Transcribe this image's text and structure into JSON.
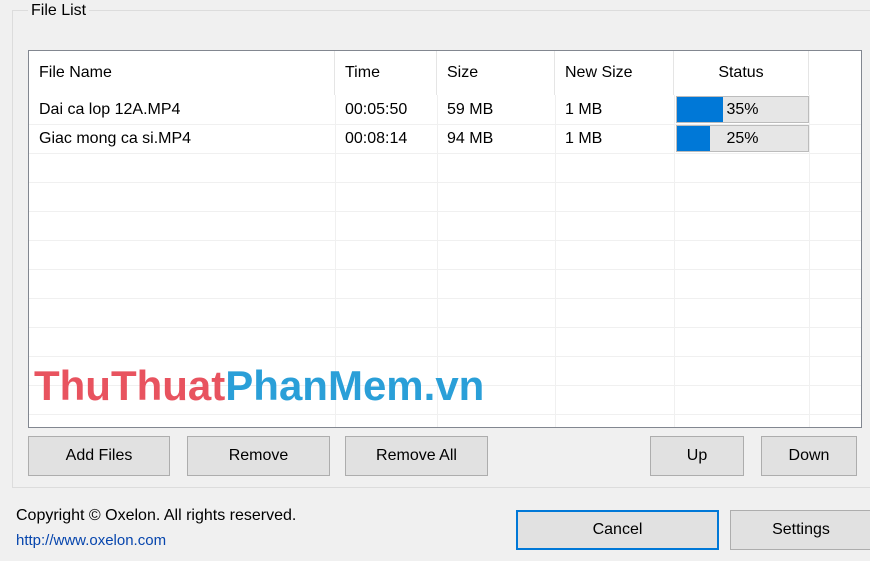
{
  "groupbox": {
    "title": "File List"
  },
  "columns": [
    {
      "label": "File Name"
    },
    {
      "label": "Time"
    },
    {
      "label": "Size"
    },
    {
      "label": "New Size"
    },
    {
      "label": "Status"
    }
  ],
  "files": [
    {
      "name": "Dai ca lop 12A.MP4",
      "time": "00:05:50",
      "size": "59 MB",
      "new_size": "1 MB",
      "status": "35%",
      "progress": 0.35
    },
    {
      "name": "Giac mong ca si.MP4",
      "time": "00:08:14",
      "size": "94 MB",
      "new_size": "1 MB",
      "status": "25%",
      "progress": 0.25
    }
  ],
  "watermark": {
    "part1": "ThuThuat",
    "part2": "PhanMem",
    "part3": ".vn",
    "color1": "#e8535f",
    "color2": "#2a9fd8"
  },
  "buttons": {
    "add_files": "Add Files",
    "remove": "Remove",
    "remove_all": "Remove All",
    "up": "Up",
    "down": "Down",
    "cancel": "Cancel",
    "settings": "Settings"
  },
  "footer": {
    "copyright": "Copyright © Oxelon. All rights reserved.",
    "url": "http://www.oxelon.com"
  },
  "colors": {
    "progress_fill": "#0078d7",
    "default_button_border": "#0078d7"
  }
}
